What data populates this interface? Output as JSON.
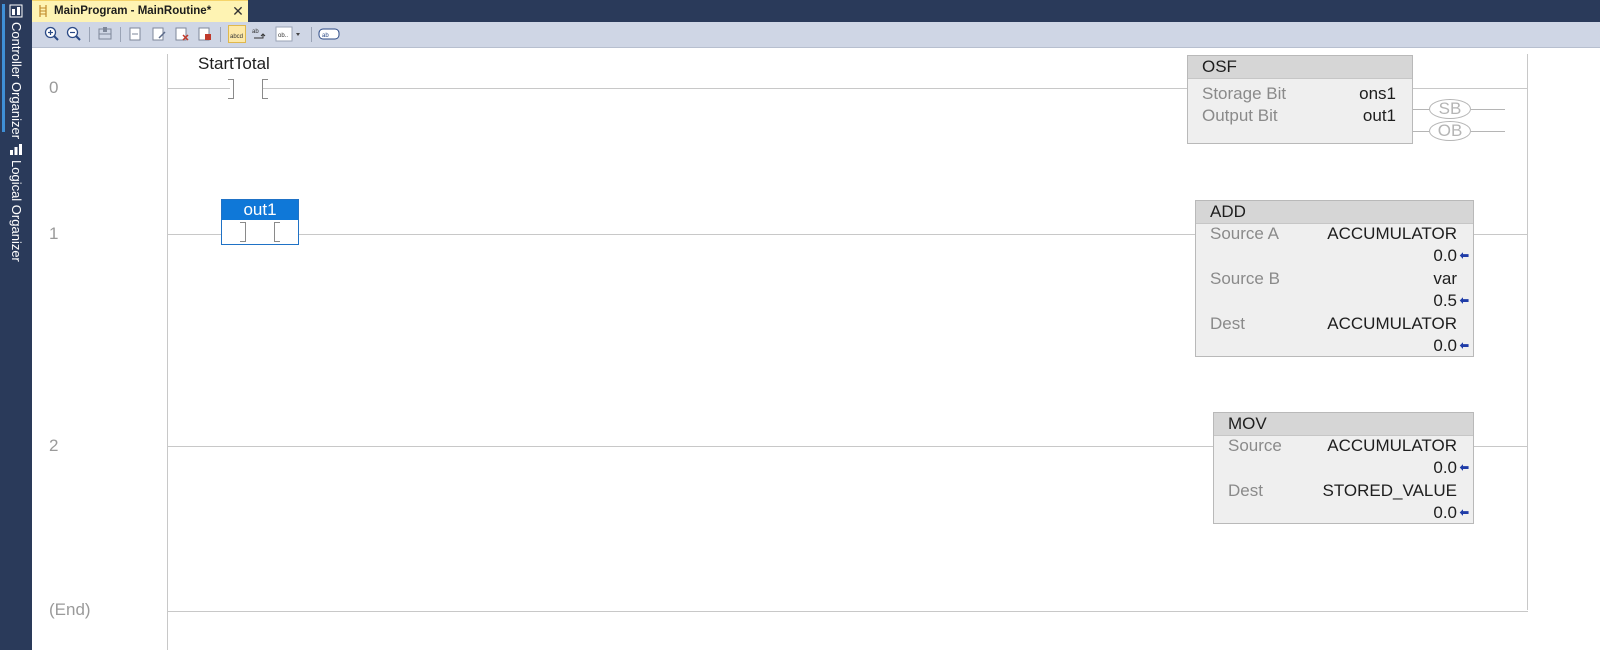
{
  "dock": {
    "tabs": [
      {
        "label": "Controller Organizer",
        "icon": "controller-organizer-icon"
      },
      {
        "label": "Logical Organizer",
        "icon": "logical-organizer-icon"
      }
    ]
  },
  "document_tab": {
    "title": "MainProgram - MainRoutine*",
    "close_symbol": "✕"
  },
  "toolbar": {
    "buttons": [
      "zoom-in-icon",
      "zoom-out-icon",
      "bookmark-icon",
      "add-rung-icon",
      "edit-rung-icon",
      "delete-rung-icon",
      "verify-rung-icon",
      "show-tag-description-icon",
      "wrap-text-icon",
      "tag-format-dropdown-icon",
      "show-instruction-text-icon"
    ],
    "active_button": "show-tag-description-icon"
  },
  "rungs": [
    {
      "number": "0",
      "contact": {
        "tag": "StartTotal"
      },
      "instruction": {
        "name": "OSF",
        "params": [
          {
            "label": "Storage Bit",
            "value": "ons1"
          },
          {
            "label": "Output Bit",
            "value": "out1"
          }
        ],
        "outputs": [
          "SB",
          "OB"
        ]
      }
    },
    {
      "number": "1",
      "contact": {
        "tag": "out1",
        "selected": true
      },
      "instruction": {
        "name": "ADD",
        "params": [
          {
            "label": "Source A",
            "value": "ACCUMULATOR",
            "live": "0.0"
          },
          {
            "label": "Source B",
            "value": "var",
            "live": "0.5"
          },
          {
            "label": "Dest",
            "value": "ACCUMULATOR",
            "live": "0.0"
          }
        ]
      }
    },
    {
      "number": "2",
      "instruction": {
        "name": "MOV",
        "params": [
          {
            "label": "Source",
            "value": "ACCUMULATOR",
            "live": "0.0"
          },
          {
            "label": "Dest",
            "value": "STORED_VALUE",
            "live": "0.0"
          }
        ]
      }
    }
  ],
  "end_label": "(End)",
  "arrow_symbol": "⬅",
  "colors": {
    "dock_bg": "#2a3a5a",
    "tab_bg": "#fef3b3",
    "toolbar_bg": "#cfd6e5",
    "selection_blue": "#0f78d8",
    "instruction_bg": "#efefef",
    "instruction_header": "#d6d6d6",
    "wire": "#c8c8c8",
    "live_arrow": "#1f3ca8"
  }
}
